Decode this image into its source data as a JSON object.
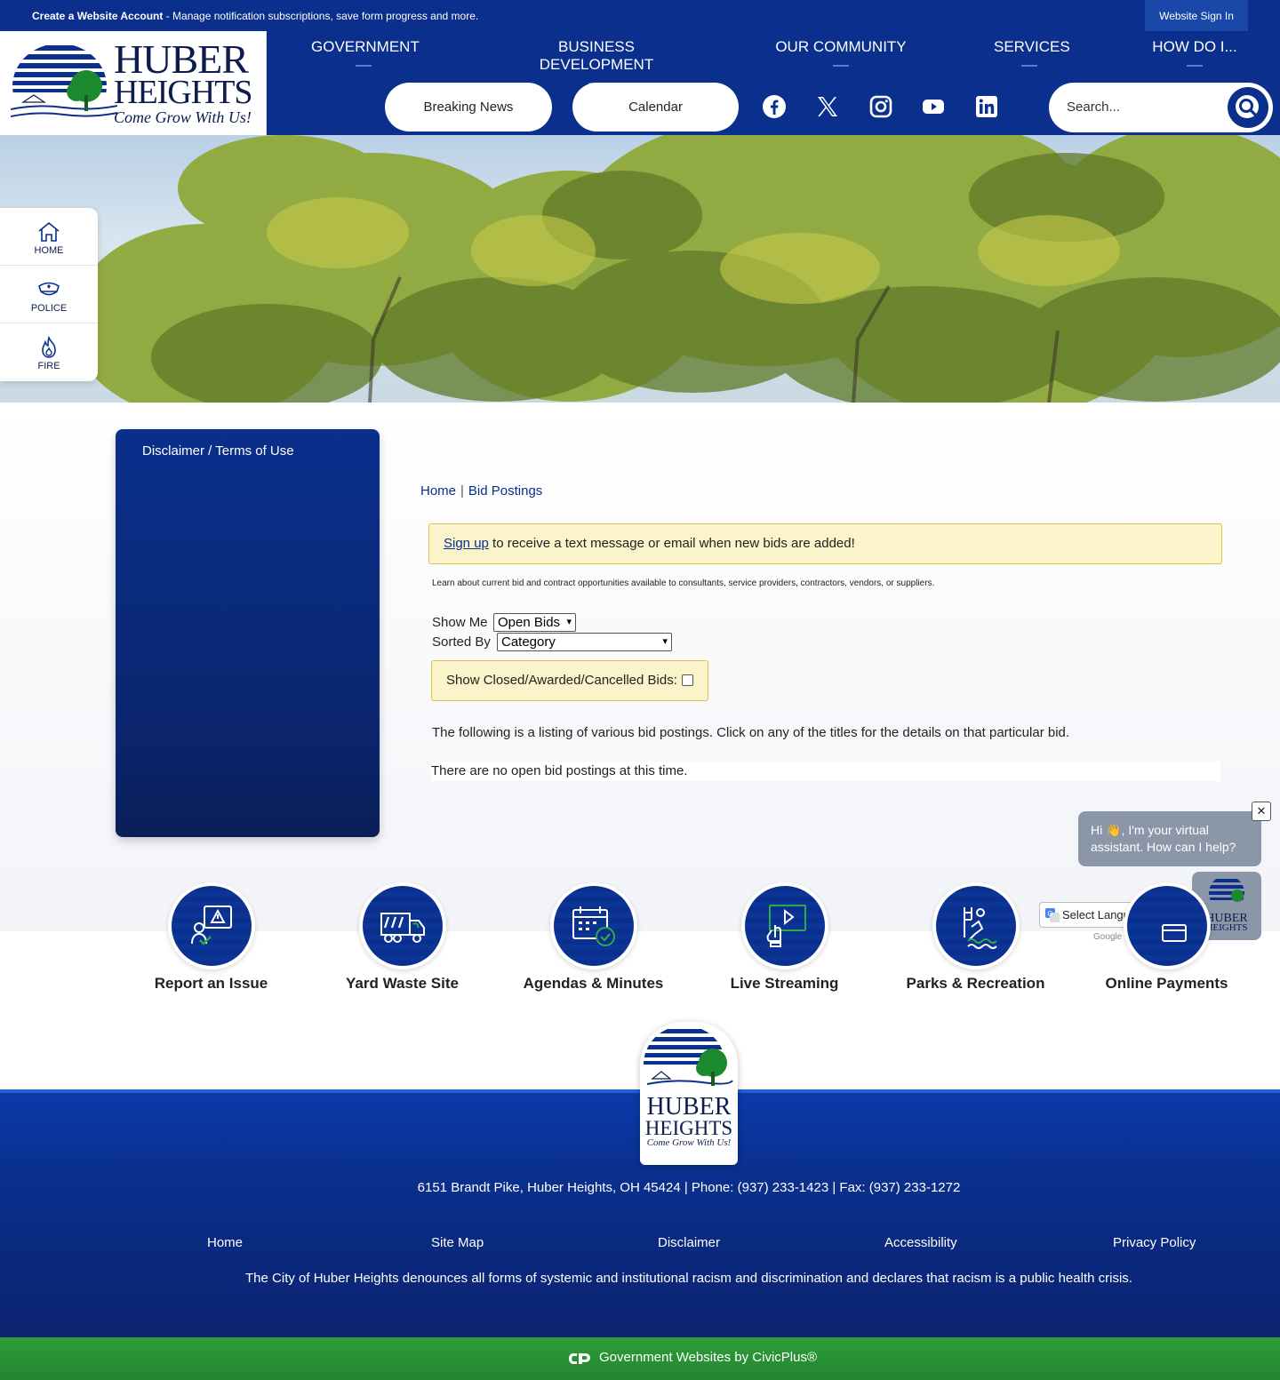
{
  "topbar": {
    "create_label": "Create a Website Account",
    "create_desc": " - Manage notification subscriptions, save form progress and more.",
    "signin": "Website Sign In"
  },
  "logo": {
    "line1": "HUBER",
    "line2": "HEIGHTS",
    "tagline": "Come Grow With Us!"
  },
  "nav": [
    "GOVERNMENT",
    "BUSINESS DEVELOPMENT",
    "OUR COMMUNITY",
    "SERVICES",
    "HOW DO I..."
  ],
  "header_buttons": [
    "Breaking News",
    "Calendar"
  ],
  "social_icons": [
    "facebook-icon",
    "x-icon",
    "instagram-icon",
    "youtube-icon",
    "linkedin-icon"
  ],
  "search": {
    "placeholder": "Search..."
  },
  "quick_links": [
    "HOME",
    "POLICE",
    "FIRE"
  ],
  "sidebar": {
    "items": [
      "Disclaimer / Terms of Use"
    ]
  },
  "breadcrumb": {
    "home": "Home",
    "current": "Bid Postings"
  },
  "alert": {
    "link": "Sign up",
    "text": " to receive a text message or email when new bids are added!"
  },
  "learn_text": "Learn about current bid and contract opportunities available to consultants, service providers, contractors, vendors, or suppliers.",
  "filters": {
    "show_me_label": "Show Me",
    "show_me_value": "Open Bids",
    "sorted_by_label": "Sorted By",
    "sorted_by_value": "Category",
    "closed_label": "Show Closed/Awarded/Cancelled Bids:"
  },
  "listing_text": "The following is a listing of various bid postings. Click on any of the titles for the details on that particular bid.",
  "no_bids_text": "There are no open bid postings at this time.",
  "chat": {
    "message": "Hi 👋, I'm your virtual assistant. How can I help?",
    "close": "✕"
  },
  "translate": {
    "label": "Select Language",
    "powered": "Google"
  },
  "features": [
    "Report an Issue",
    "Yard Waste Site",
    "Agendas & Minutes",
    "Live Streaming",
    "Parks & Recreation",
    "Online Payments"
  ],
  "footer": {
    "address": "6151 Brandt Pike, Huber Heights, OH 45424  |  Phone: (937) 233-1423  |  Fax: (937) 233-1272",
    "links": [
      "Home",
      "Site Map",
      "Disclaimer",
      "Accessibility",
      "Privacy Policy"
    ],
    "statement": "The City of Huber Heights denounces all forms of systemic and institutional racism and discrimination and declares that racism is a public health crisis.",
    "civic": "Government Websites by CivicPlus®"
  },
  "colors": {
    "brand_blue": "#0a2f8c",
    "alert_yellow": "#fbf3c9",
    "accent_green": "#2e9d3a"
  }
}
